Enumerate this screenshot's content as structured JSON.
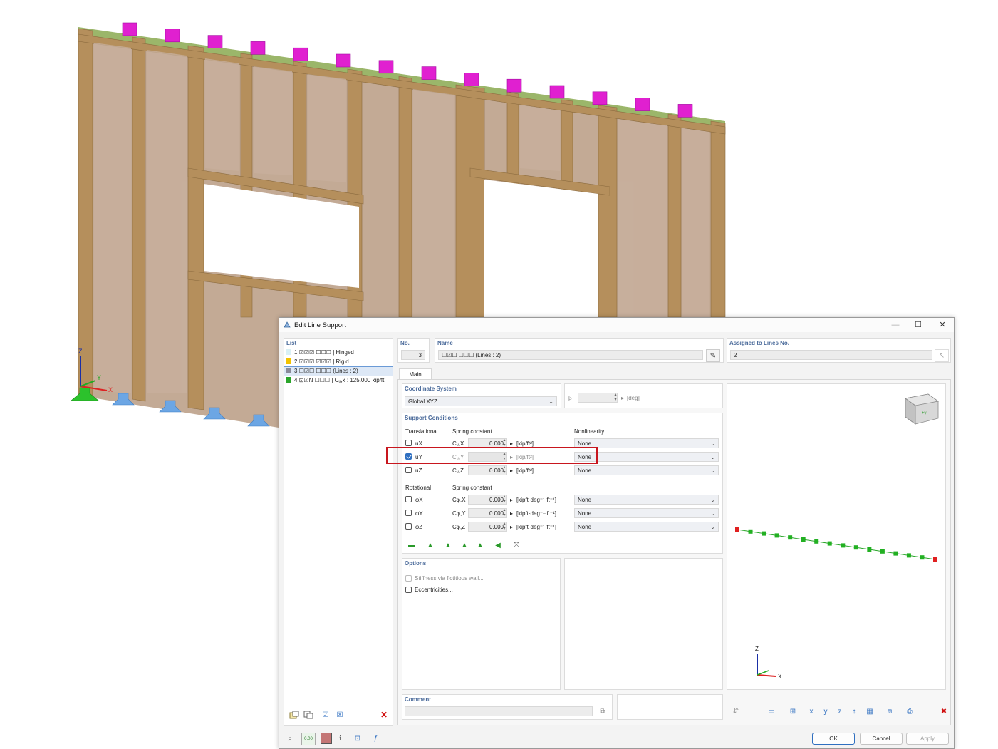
{
  "dialog": {
    "title": "Edit Line Support",
    "list_label": "List",
    "list_items": [
      {
        "no": "1",
        "code": "☑☑☑ ☐☐☐",
        "name": "| Hinged",
        "color": "#d9f0f5"
      },
      {
        "no": "2",
        "code": "☑☑☑ ☑☑☑",
        "name": "| Rigid",
        "color": "#f2c200"
      },
      {
        "no": "3",
        "code": "☐☑☐ ☐☐☐",
        "name": "(Lines : 2)",
        "color": "#8a8a9a"
      },
      {
        "no": "4",
        "code": "⊡☑N ☐☐☐",
        "name": "| Cᵤ,x : 125.000 kip/ft",
        "color": "#2aa52a"
      }
    ],
    "no_label": "No.",
    "no_value": "3",
    "name_label": "Name",
    "name_value": "☐☑☐ ☐☐☐ (Lines : 2)",
    "assigned_label": "Assigned to Lines No.",
    "assigned_value": "2",
    "tab_main": "Main",
    "coord_label": "Coordinate System",
    "coord_value": "Global XYZ",
    "beta_label": "β",
    "beta_unit": "[deg]",
    "support_label": "Support Conditions",
    "translational_label": "Translational",
    "spring_label": "Spring constant",
    "nonlinearity_label": "Nonlinearity",
    "rotational_label": "Rotational",
    "trans_rows": [
      {
        "name": "uX",
        "sym": "Cᵤ,X",
        "value": "0.000",
        "unit": "[kip/ft²]",
        "nonlin": "None",
        "checked": false
      },
      {
        "name": "uY",
        "sym": "Cᵤ,Y",
        "value": "",
        "unit": "[kip/ft²]",
        "nonlin": "None",
        "checked": true
      },
      {
        "name": "uZ",
        "sym": "Cᵤ,Z",
        "value": "0.000",
        "unit": "[kip/ft²]",
        "nonlin": "None",
        "checked": false
      }
    ],
    "rot_rows": [
      {
        "name": "φX",
        "sym": "Cφ,X",
        "value": "0.000",
        "unit": "[kipft·deg⁻¹·ft⁻¹]",
        "nonlin": "None"
      },
      {
        "name": "φY",
        "sym": "Cφ,Y",
        "value": "0.000",
        "unit": "[kipft·deg⁻¹·ft⁻¹]",
        "nonlin": "None"
      },
      {
        "name": "φZ",
        "sym": "Cφ,Z",
        "value": "0.000",
        "unit": "[kipft·deg⁻¹·ft⁻¹]",
        "nonlin": "None"
      }
    ],
    "options_label": "Options",
    "opt_stiffness": "Stiffness via fictitious wall...",
    "opt_eccentricities": "Eccentricities...",
    "comment_label": "Comment",
    "ok_label": "OK",
    "cancel_label": "Cancel",
    "apply_label": "Apply"
  },
  "preview": {
    "axis_x": "X",
    "axis_z": "Z"
  },
  "model": {
    "axis_x": "X",
    "axis_y": "Y",
    "axis_z": "Z"
  },
  "colors": {
    "highlight": "#c8161e",
    "accent": "#2f6fc0",
    "load_magenta": "#e020d0",
    "timber": "#b89766",
    "sheathing": "#c3aa95"
  }
}
